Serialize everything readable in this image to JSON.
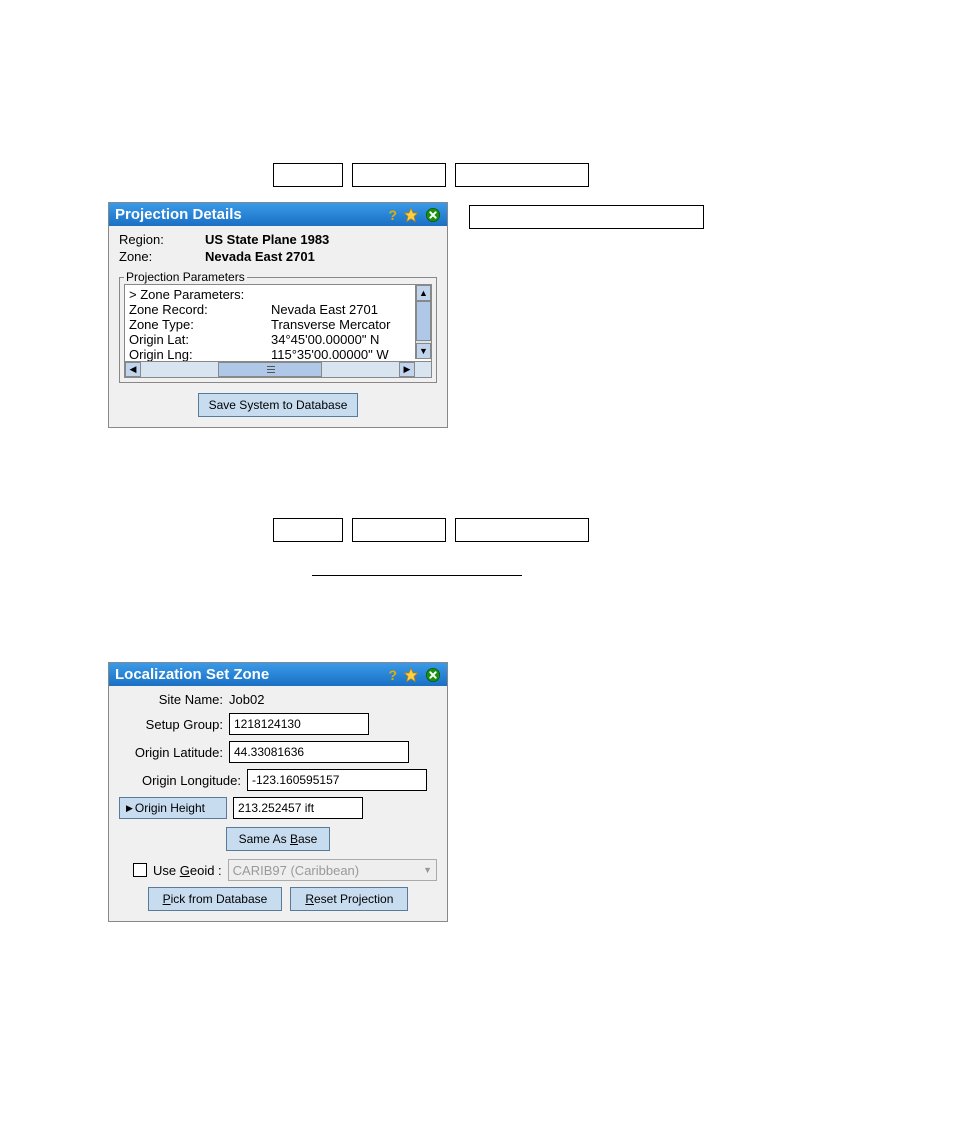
{
  "buttons_top": {
    "b1": "",
    "b2": "",
    "b3": ""
  },
  "proj_details": {
    "title": "Projection Details",
    "region_label": "Region:",
    "region_value": "US State Plane 1983",
    "zone_label": "Zone:",
    "zone_value": "Nevada East 2701",
    "params_legend": "Projection Parameters",
    "params": [
      {
        "label": "> Zone Parameters:",
        "value": ""
      },
      {
        "label": "Zone Record:",
        "value": "Nevada East 2701"
      },
      {
        "label": "Zone Type:",
        "value": "Transverse Mercator"
      },
      {
        "label": "Origin Lat:",
        "value": "34°45'00.00000\" N"
      },
      {
        "label": "Origin Lng:",
        "value": "115°35'00.00000\" W"
      }
    ],
    "save_btn": "Save System to Database"
  },
  "side_btn": "",
  "buttons_mid": {
    "b1": "",
    "b2": "",
    "b3": ""
  },
  "loc_zone": {
    "title": "Localization Set Zone",
    "site_label": "Site Name:",
    "site_value": "Job02",
    "setup_label": "Setup Group:",
    "setup_value": "1218124130",
    "olat_label": "Origin Latitude:",
    "olat_value": "44.33081636",
    "olng_label": "Origin Longitude:",
    "olng_value": "-123.160595157",
    "oheight_btn": "Origin Height",
    "oheight_value": "213.252457 ift",
    "same_btn": "Same As Base",
    "geoid_label": "Use Geoid :",
    "geoid_value": "CARIB97 (Caribbean)",
    "pick_btn": "Pick from Database",
    "reset_btn": "Reset Projection"
  }
}
